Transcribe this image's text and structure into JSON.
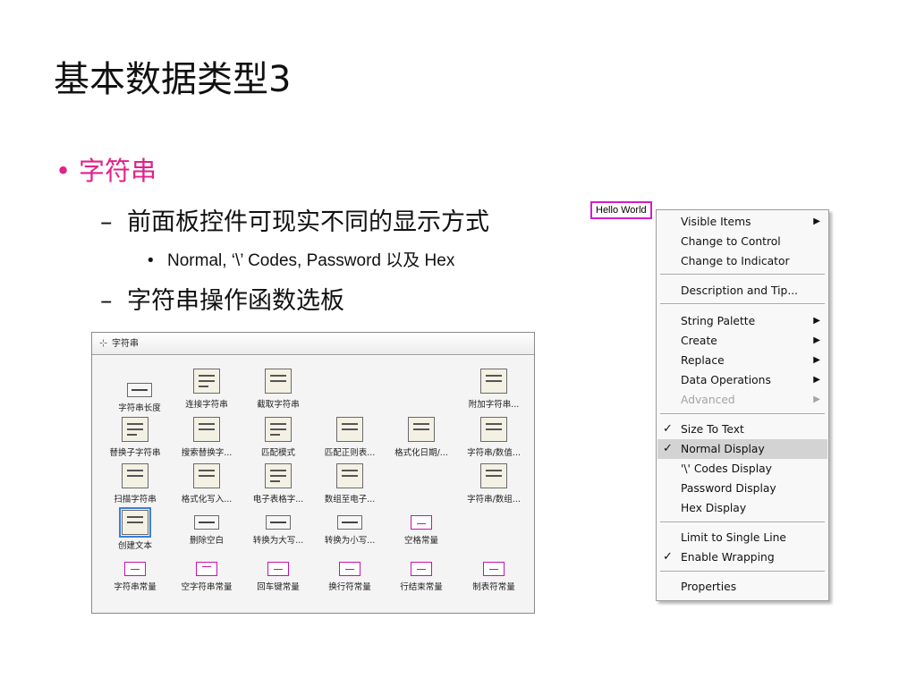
{
  "slide": {
    "title": "基本数据类型3",
    "bullet": "字符串",
    "sub1": "前面板控件可现实不同的显示方式",
    "sub1_detail": "Normal, ‘\\’ Codes, Password 以及 Hex",
    "sub2": "字符串操作函数选板"
  },
  "palette": {
    "title": "字符串",
    "items": [
      {
        "label": "字符串长度"
      },
      {
        "label": "连接字符串"
      },
      {
        "label": "截取字符串"
      },
      {
        "label": "附加字符串..."
      },
      {
        "label": "替换子字符串"
      },
      {
        "label": "搜索替换字..."
      },
      {
        "label": "匹配模式"
      },
      {
        "label": "匹配正则表..."
      },
      {
        "label": "格式化日期/..."
      },
      {
        "label": "字符串/数值..."
      },
      {
        "label": "扫描字符串"
      },
      {
        "label": "格式化写入..."
      },
      {
        "label": "电子表格字..."
      },
      {
        "label": "数组至电子..."
      },
      {
        "label": "字符串/数组..."
      },
      {
        "label": "创建文本"
      },
      {
        "label": "删除空白"
      },
      {
        "label": "转换为大写..."
      },
      {
        "label": "转换为小写..."
      },
      {
        "label": "空格常量"
      },
      {
        "label": "字符串常量"
      },
      {
        "label": "空字符串常量"
      },
      {
        "label": "回车键常量"
      },
      {
        "label": "换行符常量"
      },
      {
        "label": "行结束常量"
      },
      {
        "label": "制表符常量"
      }
    ]
  },
  "control": {
    "value": "Hello World"
  },
  "menu": {
    "items": [
      {
        "label": "Visible Items",
        "submenu": true
      },
      {
        "label": "Change to Control"
      },
      {
        "label": "Change to Indicator"
      },
      {
        "label": "Description and Tip..."
      },
      {
        "label": "String Palette",
        "submenu": true
      },
      {
        "label": "Create",
        "submenu": true
      },
      {
        "label": "Replace",
        "submenu": true
      },
      {
        "label": "Data Operations",
        "submenu": true
      },
      {
        "label": "Advanced",
        "submenu": true,
        "disabled": true
      },
      {
        "label": "Size To Text",
        "checked": true
      },
      {
        "label": "Normal Display",
        "checked": true,
        "highlighted": true
      },
      {
        "label": "'\\' Codes Display"
      },
      {
        "label": "Password Display"
      },
      {
        "label": "Hex Display"
      },
      {
        "label": "Limit to Single Line"
      },
      {
        "label": "Enable Wrapping",
        "checked": true
      },
      {
        "label": "Properties"
      }
    ],
    "check_glyph": "✓",
    "arrow_glyph": "▶"
  },
  "colors": {
    "accent": "#e0238a",
    "control_border": "#d41bd0",
    "menu_highlight": "#d3d3d3"
  }
}
